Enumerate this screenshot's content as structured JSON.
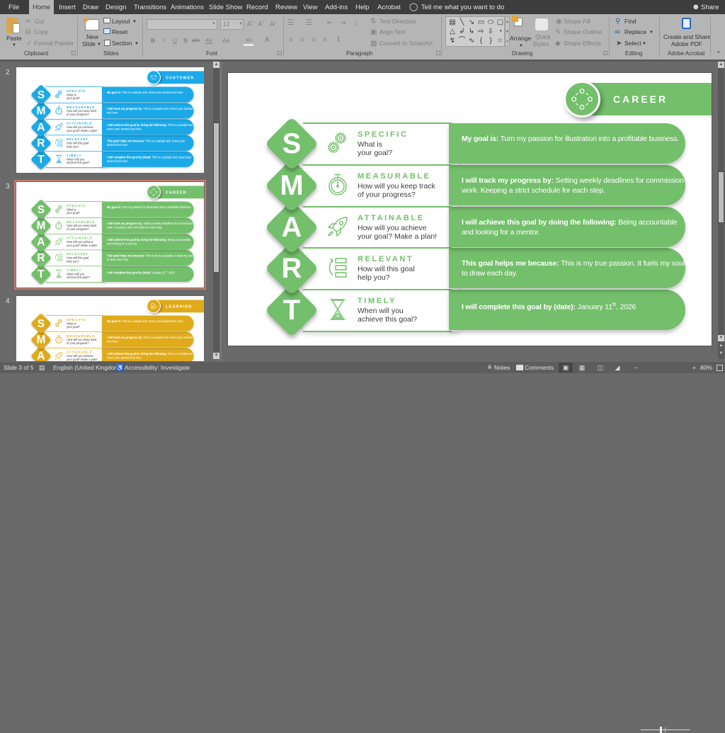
{
  "app": {
    "tell_me": "Tell me what you want to do",
    "share_label": "Share"
  },
  "tabs": [
    {
      "label": "File"
    },
    {
      "label": "Home",
      "active": true
    },
    {
      "label": "Insert"
    },
    {
      "label": "Draw"
    },
    {
      "label": "Design"
    },
    {
      "label": "Transitions"
    },
    {
      "label": "Animations"
    },
    {
      "label": "Slide Show"
    },
    {
      "label": "Record"
    },
    {
      "label": "Review"
    },
    {
      "label": "View"
    },
    {
      "label": "Add-ins"
    },
    {
      "label": "Help"
    },
    {
      "label": "Acrobat"
    }
  ],
  "ribbon": {
    "clipboard": {
      "label": "Clipboard",
      "paste": "Paste",
      "cut": "Cut",
      "copy": "Copy",
      "format_painter": "Format Painter"
    },
    "slides": {
      "label": "Slides",
      "new_slide_line1": "New",
      "new_slide_line2": "Slide",
      "layout": "Layout",
      "reset": "Reset",
      "section": "Section"
    },
    "font": {
      "label": "Font",
      "font_name": "",
      "font_size": "12",
      "bold": "B",
      "italic": "I",
      "underline": "U",
      "shadow": "S",
      "strikethrough": "abc",
      "char_spacing": "AV",
      "change_case": "Aa",
      "font_color": "A"
    },
    "paragraph": {
      "label": "Paragraph",
      "text_direction": "Text Direction",
      "align_text": "Align Text",
      "convert_smartart": "Convert to SmartArt"
    },
    "drawing": {
      "label": "Drawing",
      "arrange": "Arrange",
      "quick_styles_line1": "Quick",
      "quick_styles_line2": "Styles",
      "shape_fill": "Shape Fill",
      "shape_outline": "Shape Outline",
      "shape_effects": "Shape Effects",
      "shapes": [
        "text-box",
        "line",
        "arrow-line",
        "rectangle",
        "oval",
        "rounded-rectangle",
        "triangle",
        "elbow-connector",
        "elbow-arrow",
        "right-arrow",
        "down-arrow",
        "pie",
        "lightning",
        "arc",
        "curve",
        "left-brace",
        "right-brace",
        "star"
      ]
    },
    "editing": {
      "label": "Editing",
      "find": "Find",
      "replace": "Replace",
      "select": "Select"
    },
    "acrobat": {
      "label": "Adobe Acrobat",
      "create_line1": "Create and Share",
      "create_line2": "Adobe PDF"
    }
  },
  "colors": {
    "career_green": "#74bf6b",
    "customer_blue": "#1ba9e8",
    "learning_gold": "#e0ab1a",
    "selected_thumbnail_border": "#c77b6e"
  },
  "current_slide_index": 1,
  "slides": [
    {
      "number": "2",
      "category": "CUSTOMER",
      "category_icon": "handshake-icon",
      "theme_color": "#1ba9e8",
      "rows": [
        {
          "letter": "S",
          "title": "SPECIFIC",
          "icon": "gears-icon",
          "question": [
            "What is",
            "your goal?"
          ],
          "statement_bold": "My goal is:",
          "statement_text": " This is a sample text. Insert your desired text here."
        },
        {
          "letter": "M",
          "title": "MEASURABLE",
          "icon": "stopwatch-icon",
          "question": [
            "How will you keep track",
            "of your progress?"
          ],
          "statement_bold": "I will track my progress by:",
          "statement_text": " This is a sample text. Insert your desired text here."
        },
        {
          "letter": "A",
          "title": "ATTAINABLE",
          "icon": "rocket-icon",
          "question": [
            "How will you achieve",
            "your goal? Make a plan!"
          ],
          "statement_bold": "I will achieve this goal by doing the following:",
          "statement_text": " This is a sample text. Insert your desired text here."
        },
        {
          "letter": "R",
          "title": "RELEVANT",
          "icon": "list-cycle-icon",
          "question": [
            "How will this goal",
            "help you?"
          ],
          "statement_bold": "This goal helps me because:",
          "statement_text": " This is a sample text. Insert your desired text here."
        },
        {
          "letter": "T",
          "title": "TIMELY",
          "icon": "hourglass-icon",
          "question": [
            "When will you",
            "achieve this goal?"
          ],
          "statement_bold": "I will complete this goal by (date):",
          "statement_text": " This is a sample text. Insert your desired text here."
        }
      ]
    },
    {
      "number": "3",
      "category": "CAREER",
      "category_icon": "network-circle-icon",
      "theme_color": "#74bf6b",
      "rows": [
        {
          "letter": "S",
          "title": "SPECIFIC",
          "icon": "gears-icon",
          "question": [
            "What is",
            "your goal?"
          ],
          "statement_bold": "My goal is:",
          "statement_text": " Turn my passion for illustration into a profitable business."
        },
        {
          "letter": "M",
          "title": "MEASURABLE",
          "icon": "stopwatch-icon",
          "question": [
            "How will you keep track",
            "of your progress?"
          ],
          "statement_bold": "I will track my progress by:",
          "statement_text": " Setting weekly deadlines for commission work. Keeping a strict schedule for each step."
        },
        {
          "letter": "A",
          "title": "ATTAINABLE",
          "icon": "rocket-icon",
          "question": [
            "How will you achieve",
            "your goal? Make a plan!"
          ],
          "statement_bold": "I will achieve this goal by doing the following:",
          "statement_text": " Being accountable and looking for a mentor."
        },
        {
          "letter": "R",
          "title": "RELEVANT",
          "icon": "list-cycle-icon",
          "question": [
            "How will this goal",
            "help you?"
          ],
          "statement_bold": "This goal helps me because:",
          "statement_text": " This is my true passion. It fuels my soul to draw each day."
        },
        {
          "letter": "T",
          "title": "TIMELY",
          "icon": "hourglass-icon",
          "question": [
            "When will you",
            "achieve this goal?"
          ],
          "statement_bold": "I will complete this goal by (date):",
          "statement_text": " January 11",
          "statement_sup": "th",
          "statement_after": ", 2026"
        }
      ]
    },
    {
      "number": "4",
      "category": "LEARNING",
      "category_icon": "brain-icon",
      "theme_color": "#e0ab1a",
      "rows": [
        {
          "letter": "S",
          "title": "SPECIFIC",
          "icon": "gears-icon",
          "question": [
            "What is",
            "your goal?"
          ],
          "statement_bold": "My goal is:",
          "statement_text": " This is a sample text. Insert your desired text here."
        },
        {
          "letter": "M",
          "title": "MEASURABLE",
          "icon": "stopwatch-icon",
          "question": [
            "How will you keep track",
            "of your progress?"
          ],
          "statement_bold": "I will track my progress by:",
          "statement_text": " This is a sample text. Insert your desired text here."
        },
        {
          "letter": "A",
          "title": "ATTAINABLE",
          "icon": "rocket-icon",
          "question": [
            "How will you achieve",
            "your goal? Make a plan!"
          ],
          "statement_bold": "I will achieve this goal by doing the following:",
          "statement_text": " This is a sample text. Insert your desired text here."
        }
      ]
    }
  ],
  "status_bar": {
    "slide_indicator": "Slide 3 of 5",
    "language": "English (United Kingdom)",
    "accessibility": "Accessibility: Investigate",
    "notes": "Notes",
    "comments": "Comments",
    "zoom_level": "80%",
    "zoom_fraction": 0.4
  }
}
